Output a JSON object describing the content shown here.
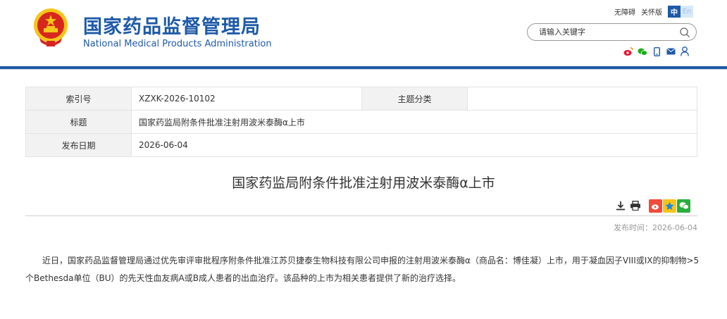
{
  "header": {
    "cn_title": "国家药品监督管理局",
    "en_title": "National Medical Products Administration",
    "top_links": [
      "无障碍",
      "关怀版"
    ],
    "lang": {
      "zh": "中",
      "en": "En"
    },
    "search_placeholder": "请输入关键字",
    "share_icons": [
      "weibo-icon",
      "wechat-icon",
      "mobile-icon",
      "mail-icon",
      "user-icon"
    ],
    "colors": {
      "brand_blue": "#1e5aa8",
      "emblem_red": "#d7261e",
      "emblem_gold": "#f5c518"
    }
  },
  "info": {
    "index_label": "索引号",
    "index_value": "XZXK-2026-10102",
    "topic_label": "主题分类",
    "topic_value": "",
    "title_label": "标题",
    "title_value": "国家药监局附条件批准注射用波米泰酶α上市",
    "date_label": "发布日期",
    "date_value": "2026-06-04"
  },
  "article": {
    "title": "国家药监局附条件批准注射用波米泰酶α上市",
    "tools": [
      "download-icon",
      "print-icon",
      "weibo-share-icon",
      "qzone-share-icon",
      "wechat-share-icon"
    ],
    "pubtime": "发布时间：2026-06-04",
    "body": "近日，国家药品监督管理局通过优先审评审批程序附条件批准江苏贝捷泰生物科技有限公司申报的注射用波米泰酶α（商品名：博佳凝）上市，用于凝血因子VIII或IX的抑制物>5个Bethesda单位（BU）的先天性血友病A或B成人患者的出血治疗。该品种的上市为相关患者提供了新的治疗选择。"
  }
}
